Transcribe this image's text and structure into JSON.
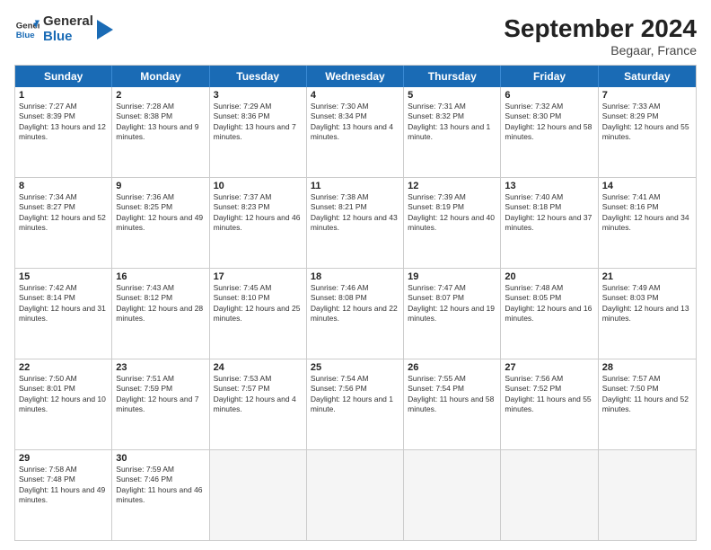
{
  "logo": {
    "line1": "General",
    "line2": "Blue"
  },
  "title": "September 2024",
  "location": "Begaar, France",
  "header_days": [
    "Sunday",
    "Monday",
    "Tuesday",
    "Wednesday",
    "Thursday",
    "Friday",
    "Saturday"
  ],
  "rows": [
    [
      {
        "day": "1",
        "sunrise": "Sunrise: 7:27 AM",
        "sunset": "Sunset: 8:39 PM",
        "daylight": "Daylight: 13 hours and 12 minutes."
      },
      {
        "day": "2",
        "sunrise": "Sunrise: 7:28 AM",
        "sunset": "Sunset: 8:38 PM",
        "daylight": "Daylight: 13 hours and 9 minutes."
      },
      {
        "day": "3",
        "sunrise": "Sunrise: 7:29 AM",
        "sunset": "Sunset: 8:36 PM",
        "daylight": "Daylight: 13 hours and 7 minutes."
      },
      {
        "day": "4",
        "sunrise": "Sunrise: 7:30 AM",
        "sunset": "Sunset: 8:34 PM",
        "daylight": "Daylight: 13 hours and 4 minutes."
      },
      {
        "day": "5",
        "sunrise": "Sunrise: 7:31 AM",
        "sunset": "Sunset: 8:32 PM",
        "daylight": "Daylight: 13 hours and 1 minute."
      },
      {
        "day": "6",
        "sunrise": "Sunrise: 7:32 AM",
        "sunset": "Sunset: 8:30 PM",
        "daylight": "Daylight: 12 hours and 58 minutes."
      },
      {
        "day": "7",
        "sunrise": "Sunrise: 7:33 AM",
        "sunset": "Sunset: 8:29 PM",
        "daylight": "Daylight: 12 hours and 55 minutes."
      }
    ],
    [
      {
        "day": "8",
        "sunrise": "Sunrise: 7:34 AM",
        "sunset": "Sunset: 8:27 PM",
        "daylight": "Daylight: 12 hours and 52 minutes."
      },
      {
        "day": "9",
        "sunrise": "Sunrise: 7:36 AM",
        "sunset": "Sunset: 8:25 PM",
        "daylight": "Daylight: 12 hours and 49 minutes."
      },
      {
        "day": "10",
        "sunrise": "Sunrise: 7:37 AM",
        "sunset": "Sunset: 8:23 PM",
        "daylight": "Daylight: 12 hours and 46 minutes."
      },
      {
        "day": "11",
        "sunrise": "Sunrise: 7:38 AM",
        "sunset": "Sunset: 8:21 PM",
        "daylight": "Daylight: 12 hours and 43 minutes."
      },
      {
        "day": "12",
        "sunrise": "Sunrise: 7:39 AM",
        "sunset": "Sunset: 8:19 PM",
        "daylight": "Daylight: 12 hours and 40 minutes."
      },
      {
        "day": "13",
        "sunrise": "Sunrise: 7:40 AM",
        "sunset": "Sunset: 8:18 PM",
        "daylight": "Daylight: 12 hours and 37 minutes."
      },
      {
        "day": "14",
        "sunrise": "Sunrise: 7:41 AM",
        "sunset": "Sunset: 8:16 PM",
        "daylight": "Daylight: 12 hours and 34 minutes."
      }
    ],
    [
      {
        "day": "15",
        "sunrise": "Sunrise: 7:42 AM",
        "sunset": "Sunset: 8:14 PM",
        "daylight": "Daylight: 12 hours and 31 minutes."
      },
      {
        "day": "16",
        "sunrise": "Sunrise: 7:43 AM",
        "sunset": "Sunset: 8:12 PM",
        "daylight": "Daylight: 12 hours and 28 minutes."
      },
      {
        "day": "17",
        "sunrise": "Sunrise: 7:45 AM",
        "sunset": "Sunset: 8:10 PM",
        "daylight": "Daylight: 12 hours and 25 minutes."
      },
      {
        "day": "18",
        "sunrise": "Sunrise: 7:46 AM",
        "sunset": "Sunset: 8:08 PM",
        "daylight": "Daylight: 12 hours and 22 minutes."
      },
      {
        "day": "19",
        "sunrise": "Sunrise: 7:47 AM",
        "sunset": "Sunset: 8:07 PM",
        "daylight": "Daylight: 12 hours and 19 minutes."
      },
      {
        "day": "20",
        "sunrise": "Sunrise: 7:48 AM",
        "sunset": "Sunset: 8:05 PM",
        "daylight": "Daylight: 12 hours and 16 minutes."
      },
      {
        "day": "21",
        "sunrise": "Sunrise: 7:49 AM",
        "sunset": "Sunset: 8:03 PM",
        "daylight": "Daylight: 12 hours and 13 minutes."
      }
    ],
    [
      {
        "day": "22",
        "sunrise": "Sunrise: 7:50 AM",
        "sunset": "Sunset: 8:01 PM",
        "daylight": "Daylight: 12 hours and 10 minutes."
      },
      {
        "day": "23",
        "sunrise": "Sunrise: 7:51 AM",
        "sunset": "Sunset: 7:59 PM",
        "daylight": "Daylight: 12 hours and 7 minutes."
      },
      {
        "day": "24",
        "sunrise": "Sunrise: 7:53 AM",
        "sunset": "Sunset: 7:57 PM",
        "daylight": "Daylight: 12 hours and 4 minutes."
      },
      {
        "day": "25",
        "sunrise": "Sunrise: 7:54 AM",
        "sunset": "Sunset: 7:56 PM",
        "daylight": "Daylight: 12 hours and 1 minute."
      },
      {
        "day": "26",
        "sunrise": "Sunrise: 7:55 AM",
        "sunset": "Sunset: 7:54 PM",
        "daylight": "Daylight: 11 hours and 58 minutes."
      },
      {
        "day": "27",
        "sunrise": "Sunrise: 7:56 AM",
        "sunset": "Sunset: 7:52 PM",
        "daylight": "Daylight: 11 hours and 55 minutes."
      },
      {
        "day": "28",
        "sunrise": "Sunrise: 7:57 AM",
        "sunset": "Sunset: 7:50 PM",
        "daylight": "Daylight: 11 hours and 52 minutes."
      }
    ],
    [
      {
        "day": "29",
        "sunrise": "Sunrise: 7:58 AM",
        "sunset": "Sunset: 7:48 PM",
        "daylight": "Daylight: 11 hours and 49 minutes."
      },
      {
        "day": "30",
        "sunrise": "Sunrise: 7:59 AM",
        "sunset": "Sunset: 7:46 PM",
        "daylight": "Daylight: 11 hours and 46 minutes."
      },
      {
        "day": "",
        "sunrise": "",
        "sunset": "",
        "daylight": ""
      },
      {
        "day": "",
        "sunrise": "",
        "sunset": "",
        "daylight": ""
      },
      {
        "day": "",
        "sunrise": "",
        "sunset": "",
        "daylight": ""
      },
      {
        "day": "",
        "sunrise": "",
        "sunset": "",
        "daylight": ""
      },
      {
        "day": "",
        "sunrise": "",
        "sunset": "",
        "daylight": ""
      }
    ]
  ]
}
